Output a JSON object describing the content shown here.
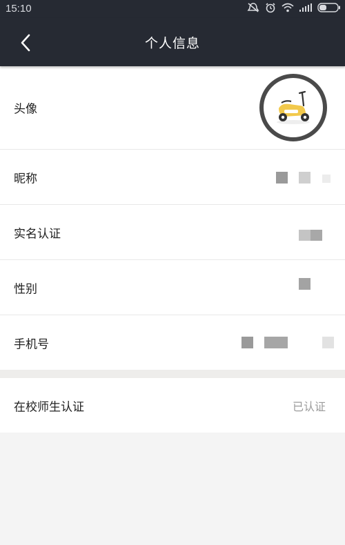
{
  "status_bar": {
    "time": "15:10"
  },
  "header": {
    "title": "个人信息",
    "back_icon": "chevron-left-icon"
  },
  "profile_rows": [
    {
      "label": "头像"
    },
    {
      "label": "昵称"
    },
    {
      "label": "实名认证"
    },
    {
      "label": "性别"
    },
    {
      "label": "手机号"
    }
  ],
  "verification_row": {
    "label": "在校师生认证",
    "value": "已认证"
  },
  "colors": {
    "header_bg": "#262a33",
    "row_bg": "#ffffff",
    "page_bg": "#f4f4f4",
    "avatar_ring": "#4a4a4a",
    "scooter_yellow": "#f2c94c"
  }
}
